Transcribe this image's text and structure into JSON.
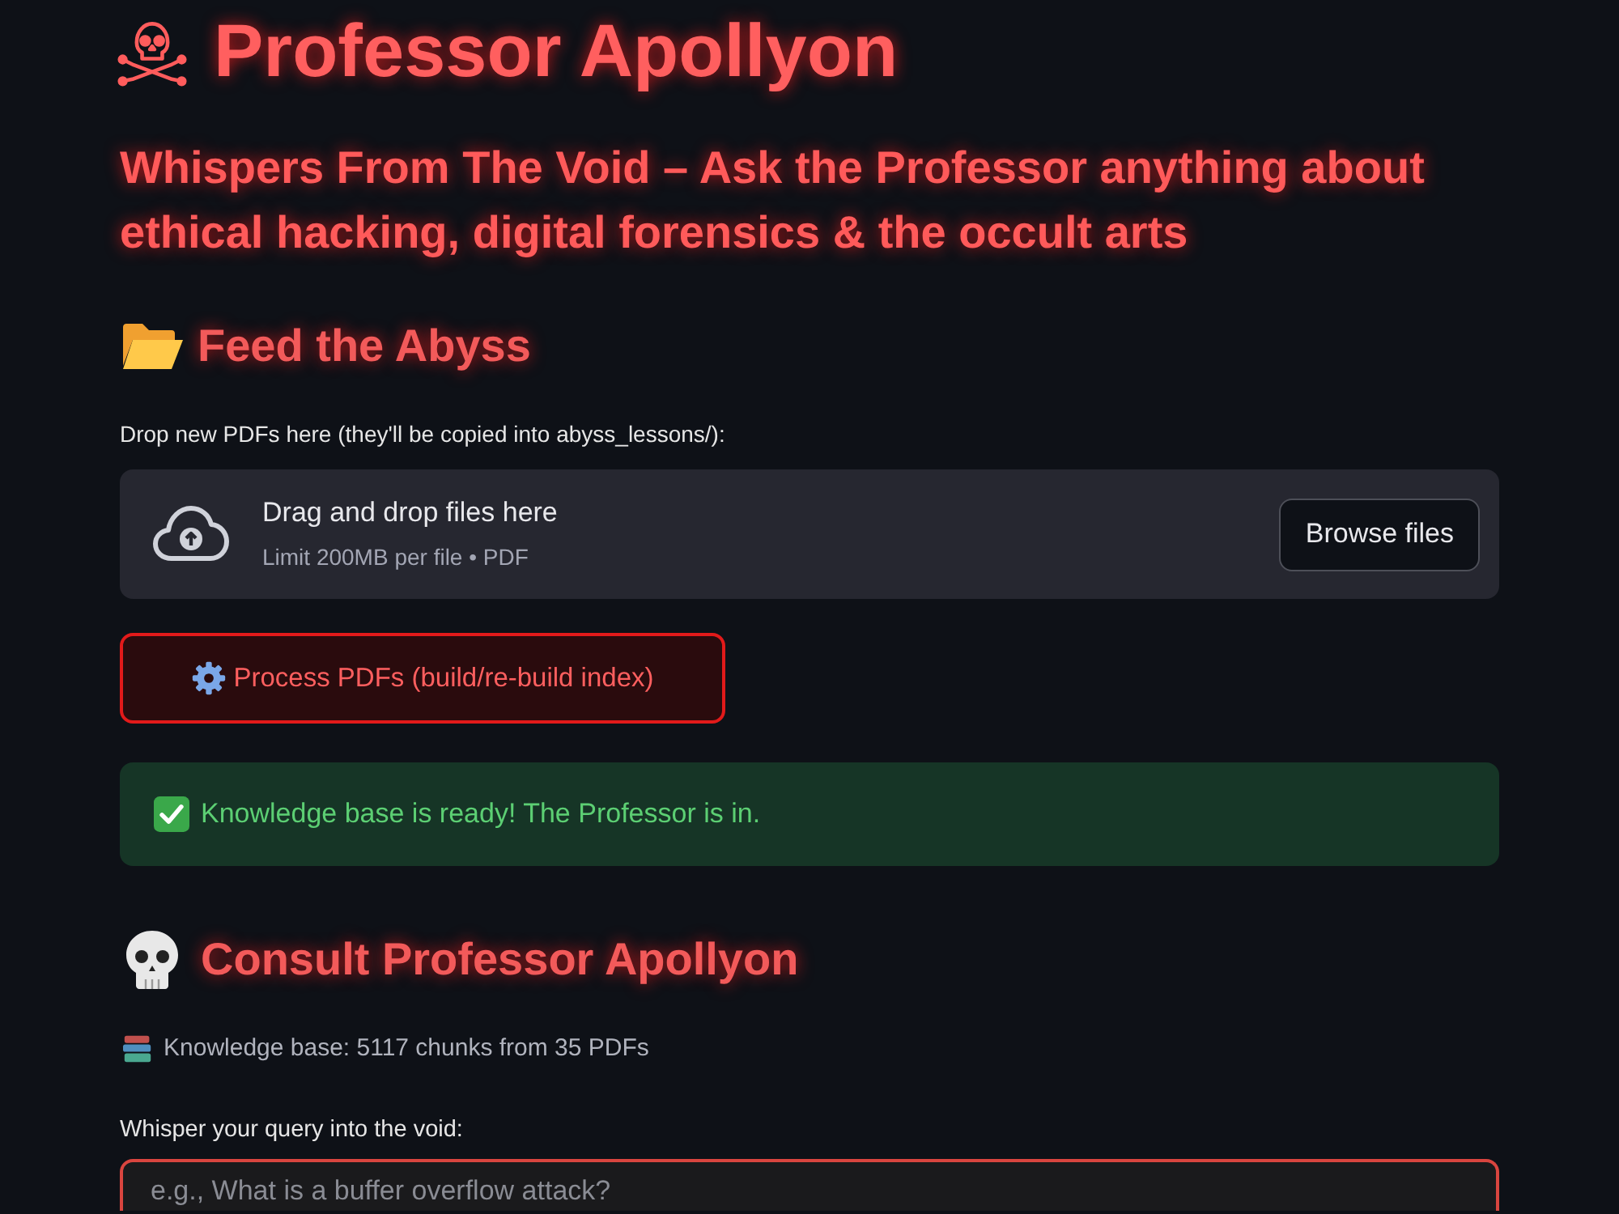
{
  "title": {
    "text": "Professor Apollyon"
  },
  "subtitle": "Whispers From The Void – Ask the Professor anything about ethical hacking, digital forensics & the occult arts",
  "upload_section": {
    "heading": "Feed the Abyss",
    "label": "Drop new PDFs here (they'll be copied into abyss_lessons/):",
    "dropzone": {
      "title": "Drag and drop files here",
      "hint": "Limit 200MB per file • PDF",
      "button": "Browse files"
    },
    "process_button": "Process PDFs (build/re-build index)",
    "alert": {
      "kind": "success",
      "text": "Knowledge base is ready! The Professor is in."
    }
  },
  "consult_section": {
    "heading": "Consult Professor Apollyon",
    "caption": "Knowledge base: 5117 chunks from 35 PDFs",
    "query": {
      "label": "Whisper your query into the void:",
      "placeholder": "e.g., What is a buffer overflow attack?",
      "focused": true
    }
  }
}
